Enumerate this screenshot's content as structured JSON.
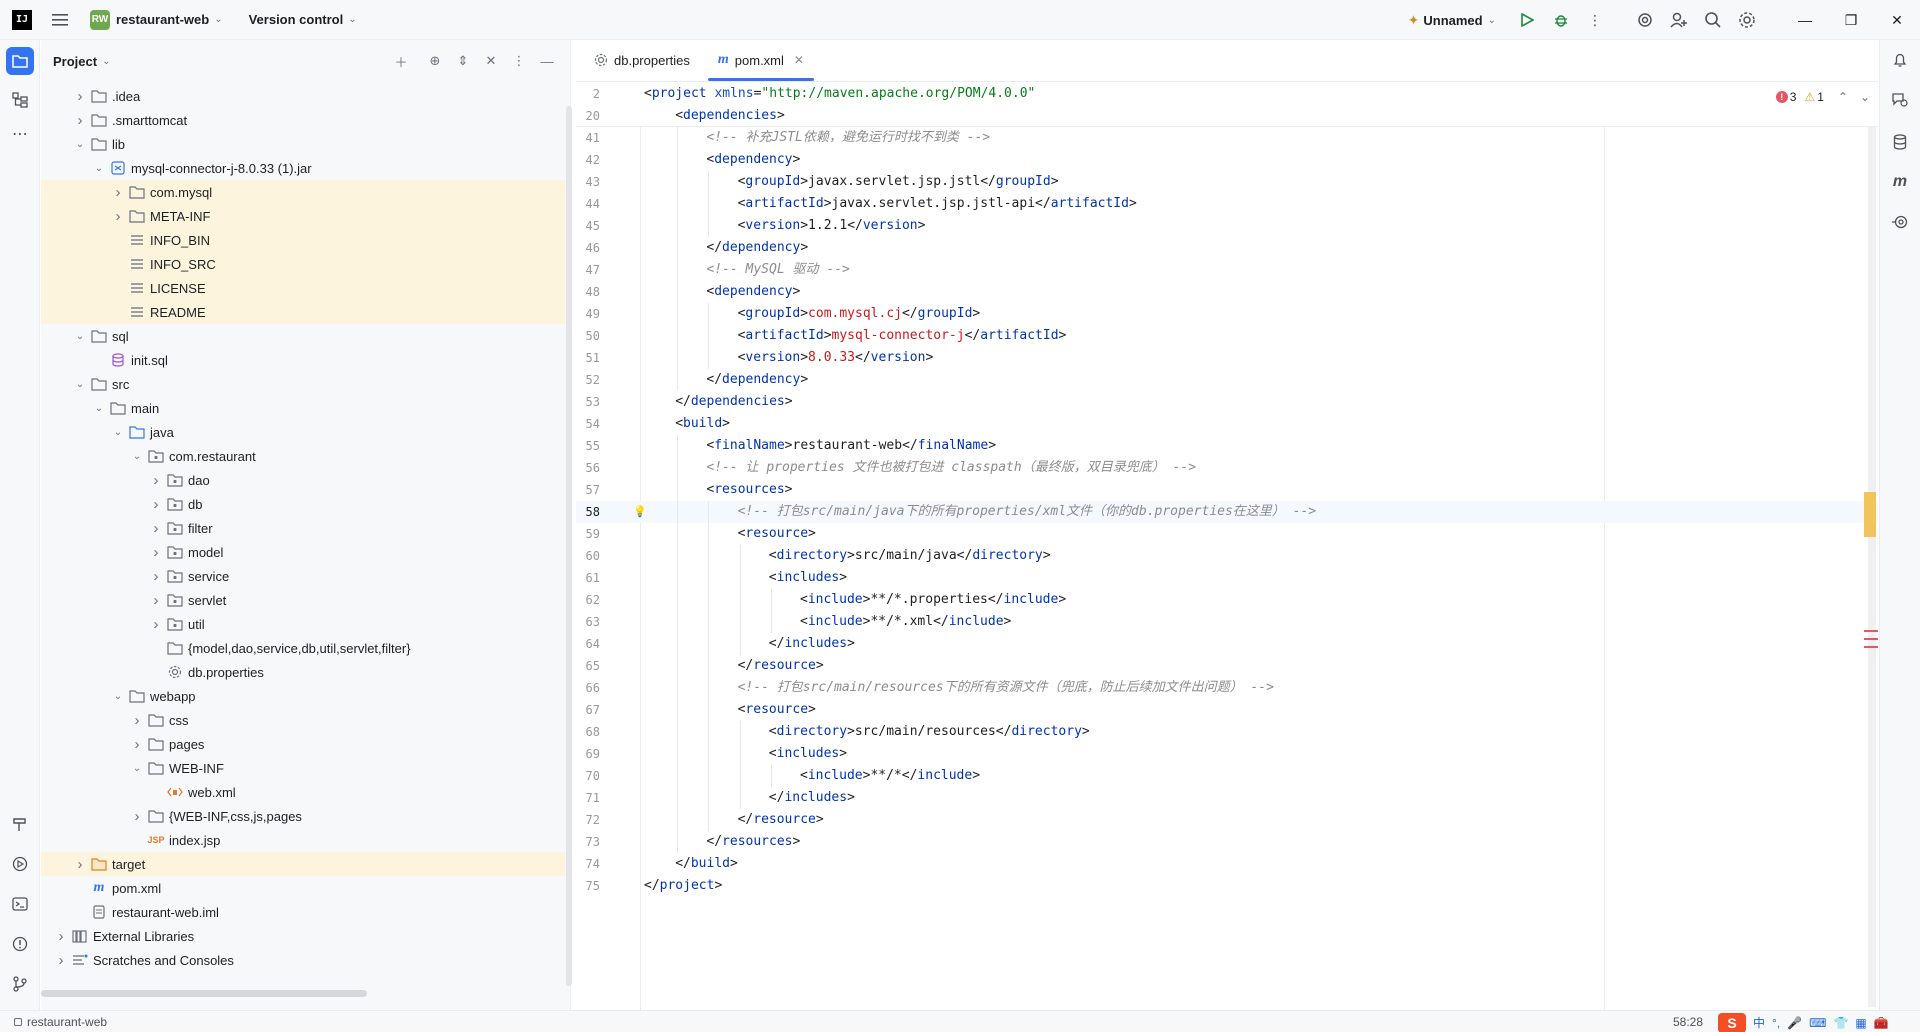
{
  "titlebar": {
    "project_badge": "RW",
    "project_name": "restaurant-web",
    "version_control": "Version control",
    "run_config": "Unnamed"
  },
  "project_panel": {
    "title": "Project",
    "tree": [
      {
        "depth": 1,
        "arrow": "right",
        "icon": "folder",
        "label": ".idea",
        "hl": false
      },
      {
        "depth": 1,
        "arrow": "right",
        "icon": "folder",
        "label": ".smarttomcat",
        "hl": false
      },
      {
        "depth": 1,
        "arrow": "down",
        "icon": "folder",
        "label": "lib",
        "hl": false
      },
      {
        "depth": 2,
        "arrow": "down",
        "icon": "jar",
        "label": "mysql-connector-j-8.0.33 (1).jar",
        "hl": false
      },
      {
        "depth": 3,
        "arrow": "right",
        "icon": "folder",
        "label": "com.mysql",
        "hl": true
      },
      {
        "depth": 3,
        "arrow": "right",
        "icon": "folder",
        "label": "META-INF",
        "hl": true
      },
      {
        "depth": 3,
        "arrow": "none",
        "icon": "text",
        "label": "INFO_BIN",
        "hl": true
      },
      {
        "depth": 3,
        "arrow": "none",
        "icon": "text",
        "label": "INFO_SRC",
        "hl": true
      },
      {
        "depth": 3,
        "arrow": "none",
        "icon": "text",
        "label": "LICENSE",
        "hl": true
      },
      {
        "depth": 3,
        "arrow": "none",
        "icon": "text",
        "label": "README",
        "hl": true
      },
      {
        "depth": 1,
        "arrow": "down",
        "icon": "folder",
        "label": "sql",
        "hl": false
      },
      {
        "depth": 2,
        "arrow": "none",
        "icon": "db",
        "label": "init.sql",
        "hl": false
      },
      {
        "depth": 1,
        "arrow": "down",
        "icon": "folder",
        "label": "src",
        "hl": false
      },
      {
        "depth": 2,
        "arrow": "down",
        "icon": "folder",
        "label": "main",
        "hl": false
      },
      {
        "depth": 3,
        "arrow": "down",
        "icon": "folder-blue",
        "label": "java",
        "hl": false
      },
      {
        "depth": 4,
        "arrow": "down",
        "icon": "package",
        "label": "com.restaurant",
        "hl": false
      },
      {
        "depth": 5,
        "arrow": "right",
        "icon": "package",
        "label": "dao",
        "hl": false
      },
      {
        "depth": 5,
        "arrow": "right",
        "icon": "package",
        "label": "db",
        "hl": false
      },
      {
        "depth": 5,
        "arrow": "right",
        "icon": "package",
        "label": "filter",
        "hl": false
      },
      {
        "depth": 5,
        "arrow": "right",
        "icon": "package",
        "label": "model",
        "hl": false
      },
      {
        "depth": 5,
        "arrow": "right",
        "icon": "package",
        "label": "service",
        "hl": false
      },
      {
        "depth": 5,
        "arrow": "right",
        "icon": "package",
        "label": "servlet",
        "hl": false
      },
      {
        "depth": 5,
        "arrow": "right",
        "icon": "package",
        "label": "util",
        "hl": false
      },
      {
        "depth": 5,
        "arrow": "none",
        "icon": "folder",
        "label": "{model,dao,service,db,util,servlet,filter}",
        "hl": false
      },
      {
        "depth": 5,
        "arrow": "none",
        "icon": "gear",
        "label": "db.properties",
        "hl": false
      },
      {
        "depth": 3,
        "arrow": "down",
        "icon": "folder",
        "label": "webapp",
        "hl": false
      },
      {
        "depth": 4,
        "arrow": "right",
        "icon": "folder",
        "label": "css",
        "hl": false
      },
      {
        "depth": 4,
        "arrow": "right",
        "icon": "folder",
        "label": "pages",
        "hl": false
      },
      {
        "depth": 4,
        "arrow": "down",
        "icon": "folder",
        "label": "WEB-INF",
        "hl": false
      },
      {
        "depth": 5,
        "arrow": "none",
        "icon": "xml",
        "label": "web.xml",
        "hl": false
      },
      {
        "depth": 4,
        "arrow": "right",
        "icon": "folder",
        "label": "{WEB-INF,css,js,pages",
        "hl": false
      },
      {
        "depth": 4,
        "arrow": "none",
        "icon": "jsp",
        "label": "index.jsp",
        "hl": false
      },
      {
        "depth": 1,
        "arrow": "right",
        "icon": "folder-orange",
        "label": "target",
        "hl": true
      },
      {
        "depth": 1,
        "arrow": "none",
        "icon": "maven",
        "label": "pom.xml",
        "hl": false
      },
      {
        "depth": 1,
        "arrow": "none",
        "icon": "iml",
        "label": "restaurant-web.iml",
        "hl": false
      },
      {
        "depth": 0,
        "arrow": "right",
        "icon": "library",
        "label": "External Libraries",
        "hl": false
      },
      {
        "depth": 0,
        "arrow": "right",
        "icon": "scratch",
        "label": "Scratches and Consoles",
        "hl": false
      }
    ]
  },
  "editor": {
    "tabs": [
      {
        "label": "db.properties",
        "active": false,
        "icon": "gear"
      },
      {
        "label": "pom.xml",
        "active": true,
        "icon": "maven"
      }
    ],
    "errors": "3",
    "warnings": "1",
    "sticky": [
      {
        "n": "2",
        "indent": 0,
        "tokens": [
          [
            "br",
            "<"
          ],
          [
            "tag",
            "project "
          ],
          [
            "attr",
            "xmlns"
          ],
          [
            "br",
            "="
          ],
          [
            "str",
            "\"http://maven.apache.org/POM/4.0.0\""
          ]
        ]
      },
      {
        "n": "20",
        "indent": 1,
        "tokens": [
          [
            "br",
            "<"
          ],
          [
            "tag",
            "dependencies"
          ],
          [
            "br",
            ">"
          ]
        ]
      }
    ],
    "lines": [
      {
        "n": "41",
        "indent": 2,
        "tokens": [
          [
            "cmt",
            "<!-- 补充JSTL依赖，避免运行时找不到类 -->"
          ]
        ]
      },
      {
        "n": "42",
        "indent": 2,
        "tokens": [
          [
            "br",
            "<"
          ],
          [
            "tag",
            "dependency"
          ],
          [
            "br",
            ">"
          ]
        ]
      },
      {
        "n": "43",
        "indent": 3,
        "tokens": [
          [
            "br",
            "<"
          ],
          [
            "tag",
            "groupId"
          ],
          [
            "br",
            ">"
          ],
          [
            "tx",
            "javax.servlet.jsp.jstl"
          ],
          [
            "br",
            "</"
          ],
          [
            "tag",
            "groupId"
          ],
          [
            "br",
            ">"
          ]
        ]
      },
      {
        "n": "44",
        "indent": 3,
        "tokens": [
          [
            "br",
            "<"
          ],
          [
            "tag",
            "artifactId"
          ],
          [
            "br",
            ">"
          ],
          [
            "tx",
            "javax.servlet.jsp.jstl-api"
          ],
          [
            "br",
            "</"
          ],
          [
            "tag",
            "artifactId"
          ],
          [
            "br",
            ">"
          ]
        ]
      },
      {
        "n": "45",
        "indent": 3,
        "tokens": [
          [
            "br",
            "<"
          ],
          [
            "tag",
            "version"
          ],
          [
            "br",
            ">"
          ],
          [
            "tx",
            "1.2.1"
          ],
          [
            "br",
            "</"
          ],
          [
            "tag",
            "version"
          ],
          [
            "br",
            ">"
          ]
        ]
      },
      {
        "n": "46",
        "indent": 2,
        "tokens": [
          [
            "br",
            "</"
          ],
          [
            "tag",
            "dependency"
          ],
          [
            "br",
            ">"
          ]
        ]
      },
      {
        "n": "47",
        "indent": 2,
        "tokens": [
          [
            "cmt",
            "<!-- MySQL 驱动 -->"
          ]
        ]
      },
      {
        "n": "48",
        "indent": 2,
        "tokens": [
          [
            "br",
            "<"
          ],
          [
            "tag",
            "dependency"
          ],
          [
            "br",
            ">"
          ]
        ]
      },
      {
        "n": "49",
        "indent": 3,
        "tokens": [
          [
            "br",
            "<"
          ],
          [
            "tag",
            "groupId"
          ],
          [
            "br",
            ">"
          ],
          [
            "val",
            "com.mysql.cj"
          ],
          [
            "br",
            "</"
          ],
          [
            "tag",
            "groupId"
          ],
          [
            "br",
            ">"
          ]
        ]
      },
      {
        "n": "50",
        "indent": 3,
        "tokens": [
          [
            "br",
            "<"
          ],
          [
            "tag",
            "artifactId"
          ],
          [
            "br",
            ">"
          ],
          [
            "val",
            "mysql-connector-j"
          ],
          [
            "br",
            "</"
          ],
          [
            "tag",
            "artifactId"
          ],
          [
            "br",
            ">"
          ]
        ]
      },
      {
        "n": "51",
        "indent": 3,
        "tokens": [
          [
            "br",
            "<"
          ],
          [
            "tag",
            "version"
          ],
          [
            "br",
            ">"
          ],
          [
            "val",
            "8.0.33"
          ],
          [
            "br",
            "</"
          ],
          [
            "tag",
            "version"
          ],
          [
            "br",
            ">"
          ]
        ]
      },
      {
        "n": "52",
        "indent": 2,
        "tokens": [
          [
            "br",
            "</"
          ],
          [
            "tag",
            "dependency"
          ],
          [
            "br",
            ">"
          ]
        ]
      },
      {
        "n": "53",
        "indent": 1,
        "tokens": [
          [
            "br",
            "</"
          ],
          [
            "tag",
            "dependencies"
          ],
          [
            "br",
            ">"
          ]
        ]
      },
      {
        "n": "54",
        "indent": 1,
        "tokens": [
          [
            "br",
            "<"
          ],
          [
            "tag",
            "build"
          ],
          [
            "br",
            ">"
          ]
        ]
      },
      {
        "n": "55",
        "indent": 2,
        "tokens": [
          [
            "br",
            "<"
          ],
          [
            "tag",
            "finalName"
          ],
          [
            "br",
            ">"
          ],
          [
            "tx",
            "restaurant-web"
          ],
          [
            "br",
            "</"
          ],
          [
            "tag",
            "finalName"
          ],
          [
            "br",
            ">"
          ]
        ]
      },
      {
        "n": "56",
        "indent": 2,
        "tokens": [
          [
            "cmt",
            "<!-- 让 properties 文件也被打包进 classpath（最终版，双目录兜底） -->"
          ]
        ]
      },
      {
        "n": "57",
        "indent": 2,
        "tokens": [
          [
            "br",
            "<"
          ],
          [
            "tag",
            "resources"
          ],
          [
            "br",
            ">"
          ]
        ]
      },
      {
        "n": "58",
        "indent": 3,
        "current": true,
        "tokens": [
          [
            "cmt",
            "<!-- 打包src/main/java下的所有properties/xml文件（你的db.properties在这里） -->"
          ]
        ]
      },
      {
        "n": "59",
        "indent": 3,
        "tokens": [
          [
            "br",
            "<"
          ],
          [
            "tag",
            "resource"
          ],
          [
            "br",
            ">"
          ]
        ]
      },
      {
        "n": "60",
        "indent": 4,
        "tokens": [
          [
            "br",
            "<"
          ],
          [
            "tag",
            "directory"
          ],
          [
            "br",
            ">"
          ],
          [
            "tx",
            "src/main/java"
          ],
          [
            "br",
            "</"
          ],
          [
            "tag",
            "directory"
          ],
          [
            "br",
            ">"
          ]
        ]
      },
      {
        "n": "61",
        "indent": 4,
        "tokens": [
          [
            "br",
            "<"
          ],
          [
            "tag",
            "includes"
          ],
          [
            "br",
            ">"
          ]
        ]
      },
      {
        "n": "62",
        "indent": 5,
        "tokens": [
          [
            "br",
            "<"
          ],
          [
            "tag",
            "include"
          ],
          [
            "br",
            ">"
          ],
          [
            "tx",
            "**/*.properties"
          ],
          [
            "br",
            "</"
          ],
          [
            "tag",
            "include"
          ],
          [
            "br",
            ">"
          ]
        ]
      },
      {
        "n": "63",
        "indent": 5,
        "tokens": [
          [
            "br",
            "<"
          ],
          [
            "tag",
            "include"
          ],
          [
            "br",
            ">"
          ],
          [
            "tx",
            "**/*.xml"
          ],
          [
            "br",
            "</"
          ],
          [
            "tag",
            "include"
          ],
          [
            "br",
            ">"
          ]
        ]
      },
      {
        "n": "64",
        "indent": 4,
        "tokens": [
          [
            "br",
            "</"
          ],
          [
            "tag",
            "includes"
          ],
          [
            "br",
            ">"
          ]
        ]
      },
      {
        "n": "65",
        "indent": 3,
        "tokens": [
          [
            "br",
            "</"
          ],
          [
            "tag",
            "resource"
          ],
          [
            "br",
            ">"
          ]
        ]
      },
      {
        "n": "66",
        "indent": 3,
        "tokens": [
          [
            "cmt",
            "<!-- 打包src/main/resources下的所有资源文件（兜底，防止后续加文件出问题） -->"
          ]
        ]
      },
      {
        "n": "67",
        "indent": 3,
        "tokens": [
          [
            "br",
            "<"
          ],
          [
            "tag",
            "resource"
          ],
          [
            "br",
            ">"
          ]
        ]
      },
      {
        "n": "68",
        "indent": 4,
        "tokens": [
          [
            "br",
            "<"
          ],
          [
            "tag",
            "directory"
          ],
          [
            "br",
            ">"
          ],
          [
            "tx",
            "src/main/resources"
          ],
          [
            "br",
            "</"
          ],
          [
            "tag",
            "directory"
          ],
          [
            "br",
            ">"
          ]
        ]
      },
      {
        "n": "69",
        "indent": 4,
        "tokens": [
          [
            "br",
            "<"
          ],
          [
            "tag",
            "includes"
          ],
          [
            "br",
            ">"
          ]
        ]
      },
      {
        "n": "70",
        "indent": 5,
        "tokens": [
          [
            "br",
            "<"
          ],
          [
            "tag",
            "include"
          ],
          [
            "br",
            ">"
          ],
          [
            "tx",
            "**/*"
          ],
          [
            "br",
            "</"
          ],
          [
            "tag",
            "include"
          ],
          [
            "br",
            ">"
          ]
        ]
      },
      {
        "n": "71",
        "indent": 4,
        "tokens": [
          [
            "br",
            "</"
          ],
          [
            "tag",
            "includes"
          ],
          [
            "br",
            ">"
          ]
        ]
      },
      {
        "n": "72",
        "indent": 3,
        "tokens": [
          [
            "br",
            "</"
          ],
          [
            "tag",
            "resource"
          ],
          [
            "br",
            ">"
          ]
        ]
      },
      {
        "n": "73",
        "indent": 2,
        "tokens": [
          [
            "br",
            "</"
          ],
          [
            "tag",
            "resources"
          ],
          [
            "br",
            ">"
          ]
        ]
      },
      {
        "n": "74",
        "indent": 1,
        "tokens": [
          [
            "br",
            "</"
          ],
          [
            "tag",
            "build"
          ],
          [
            "br",
            ">"
          ]
        ]
      },
      {
        "n": "75",
        "indent": 0,
        "tokens": [
          [
            "br",
            "</"
          ],
          [
            "tag",
            "project"
          ],
          [
            "br",
            ">"
          ]
        ]
      }
    ]
  },
  "statusbar": {
    "project": "restaurant-web",
    "position": "58:28",
    "ime": [
      "中",
      "°,",
      "🎤",
      "⌨",
      "👕",
      "▦",
      "🧰"
    ]
  }
}
